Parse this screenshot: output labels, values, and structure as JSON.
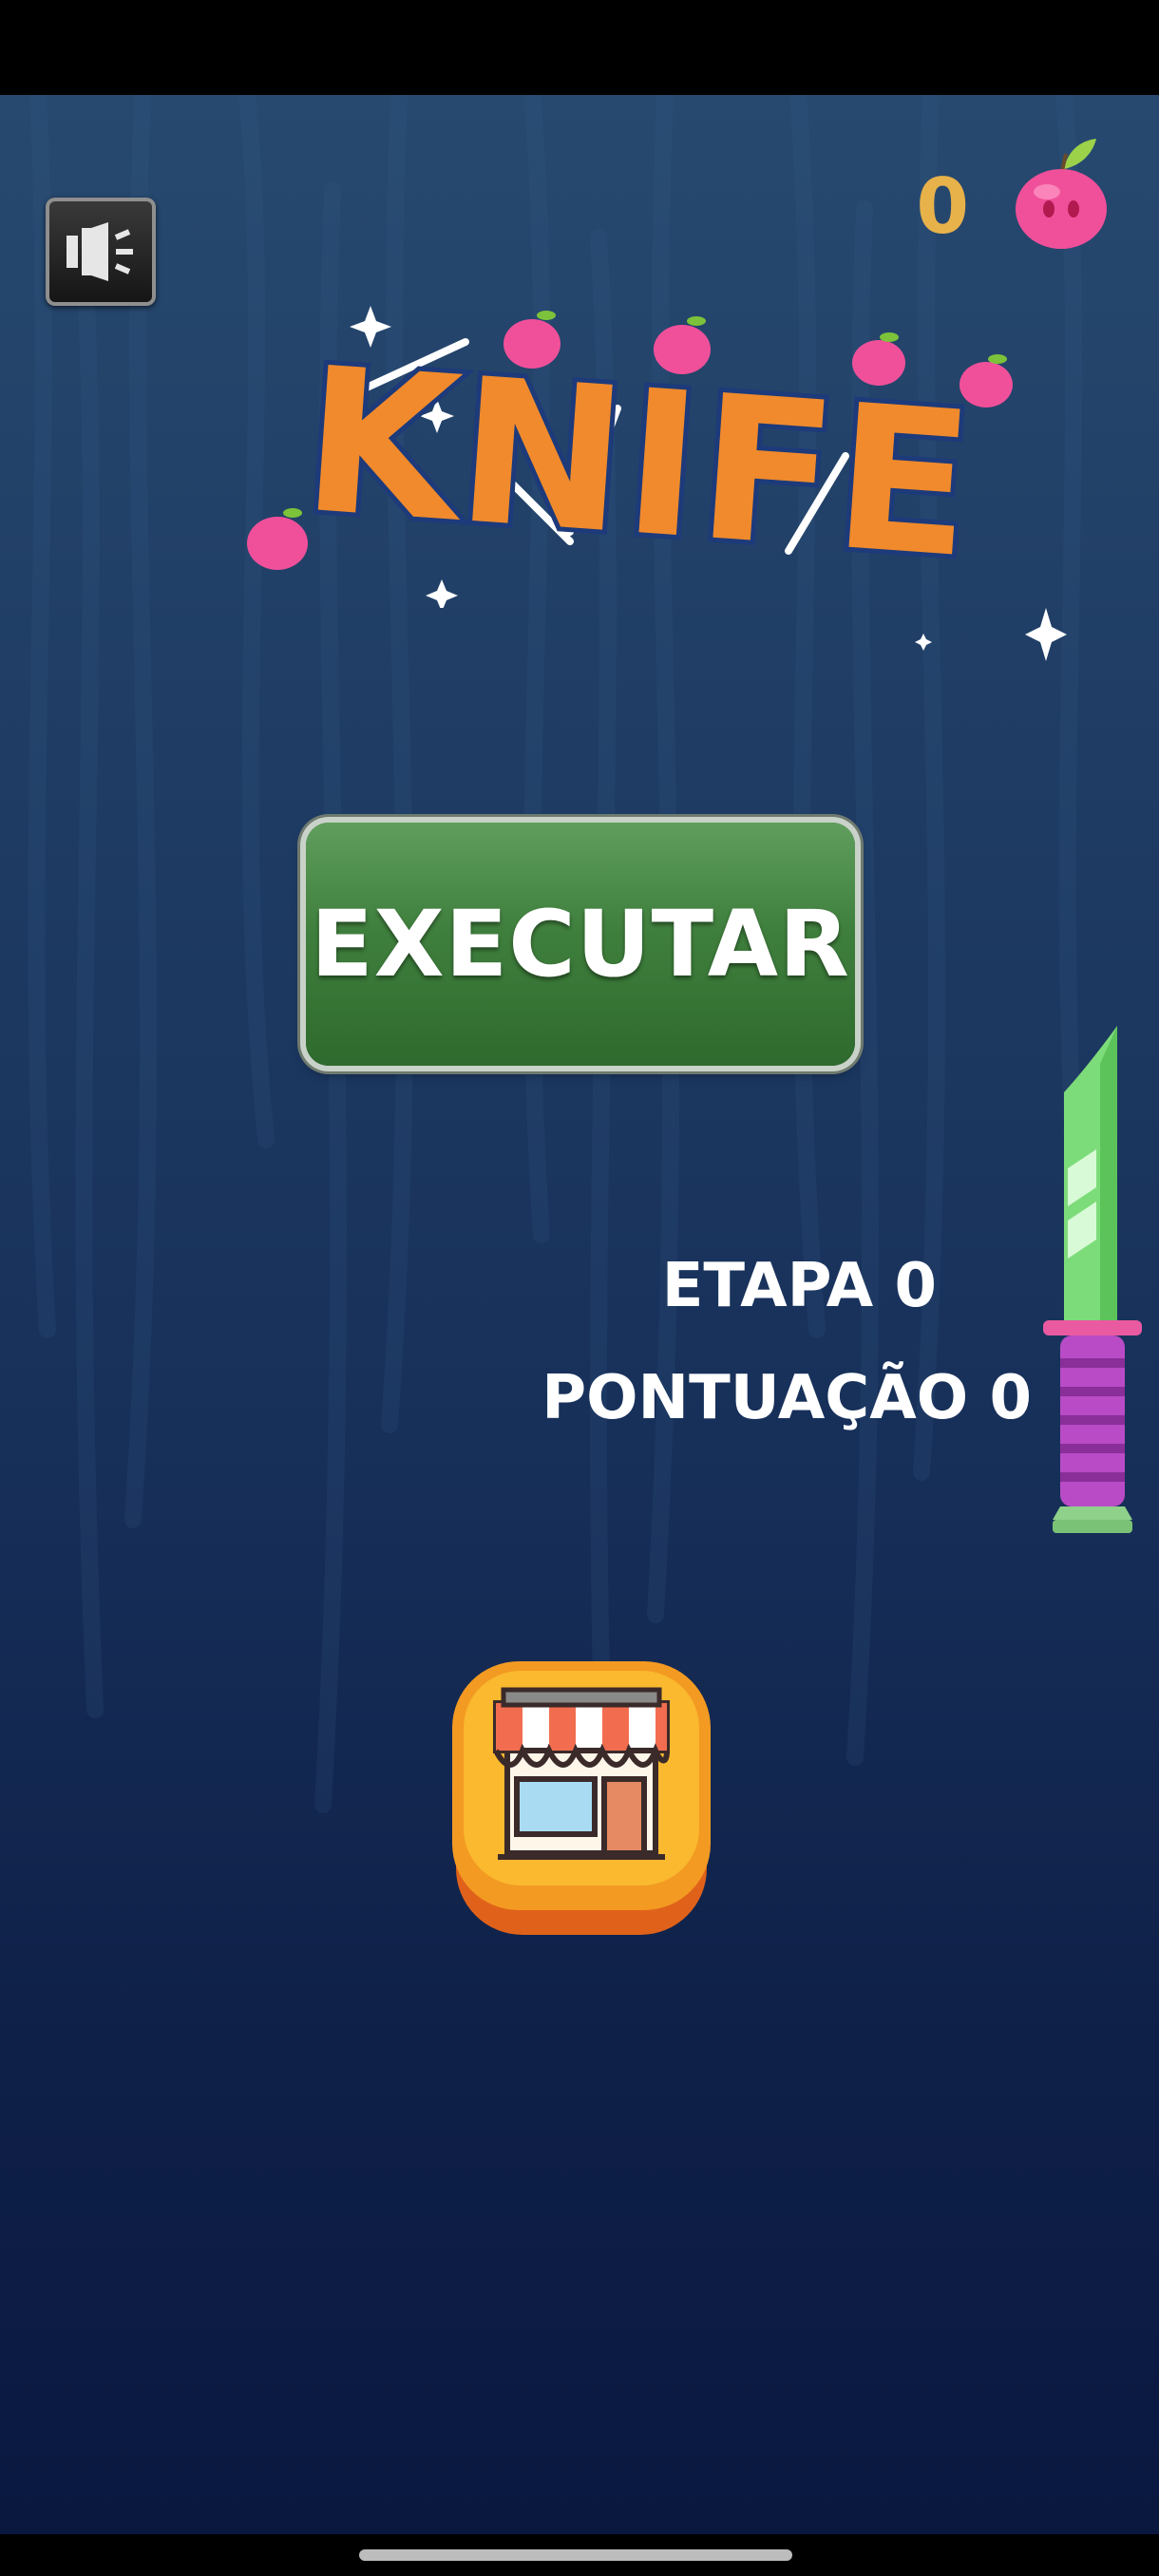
{
  "hud": {
    "coins": "0",
    "sound_icon": "speaker-icon",
    "coin_icon": "apple-icon"
  },
  "logo": {
    "text": "KNIFE"
  },
  "menu": {
    "play_label": "EXECUTAR",
    "shop_icon": "shop-icon"
  },
  "stats": {
    "stage_label": "ETAPA",
    "stage_value": "0",
    "score_label": "PONTUAÇÃO",
    "score_value": "0"
  },
  "colors": {
    "background_top": "#27496f",
    "background_bottom": "#0a1840",
    "play_button": "#3f7f3d",
    "logo_orange": "#f08a2c",
    "coin_text": "#e8b24a",
    "knife_blade": "#7ddc7a",
    "knife_handle": "#b94bc6"
  }
}
